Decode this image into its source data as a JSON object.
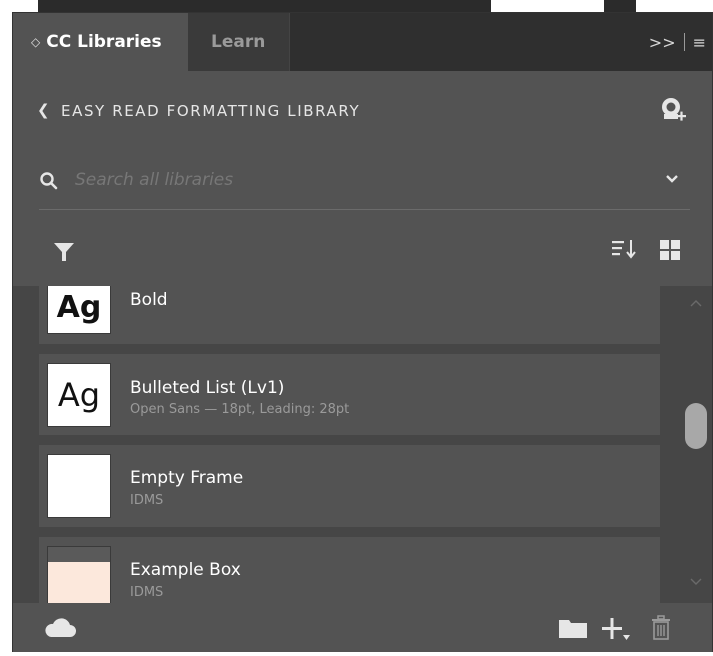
{
  "tabs": [
    {
      "label": "CC Libraries",
      "active": true
    },
    {
      "label": "Learn",
      "active": false
    }
  ],
  "header": {
    "library_name": "EASY READ FORMATTING LIBRARY"
  },
  "search": {
    "placeholder": "Search all libraries",
    "value": ""
  },
  "items": [
    {
      "thumbnail_text": "Ag",
      "name": "Bold",
      "detail": ""
    },
    {
      "thumbnail_text": "Ag",
      "name": "Bulleted List (Lv1)",
      "detail": "Open Sans — 18pt, Leading: 28pt"
    },
    {
      "thumbnail_text": "",
      "name": "Empty Frame",
      "detail": "IDMS"
    },
    {
      "thumbnail_text": "",
      "name": "Example Box",
      "detail": "IDMS"
    }
  ],
  "colors": {
    "panel_bg": "#535353",
    "tabbar_bg": "#2f2f2f",
    "list_bg": "#464646",
    "example_box_fill": "#fce8dc",
    "example_box_header": "#5a5a5a"
  }
}
